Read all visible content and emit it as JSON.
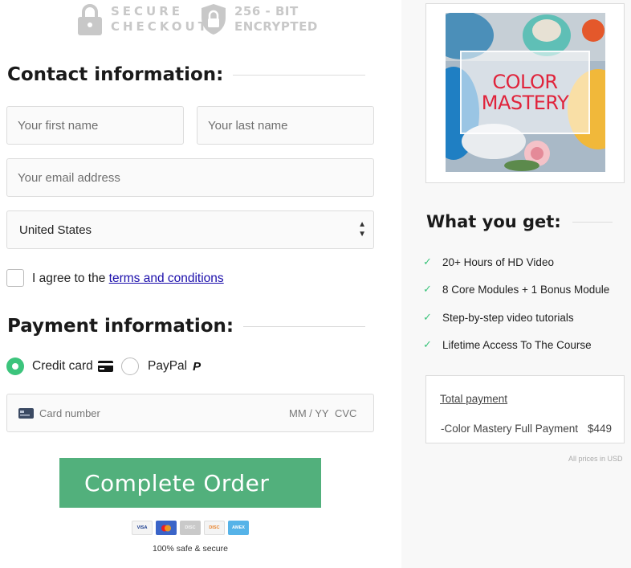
{
  "badges": {
    "secure_line1": "SECURE",
    "secure_line2": "CHECKOUT",
    "encrypt_line1": "256 - BIT",
    "encrypt_line2": "ENCRYPTED"
  },
  "contact": {
    "title": "Contact information:",
    "first_name_placeholder": "Your first name",
    "last_name_placeholder": "Your last name",
    "email_placeholder": "Your email address",
    "country": "United States",
    "agree_text": "I agree to the",
    "terms_link": "terms and conditions"
  },
  "payment": {
    "title": "Payment information:",
    "credit_card_label": "Credit card",
    "paypal_label": "PayPal",
    "card_number_placeholder": "Card number",
    "expiry_placeholder": "MM / YY",
    "cvc_placeholder": "CVC",
    "complete_button": "Complete Order",
    "card_brands": [
      "VISA",
      "MC",
      "DISC",
      "DISC",
      "AMEX"
    ],
    "safe_text": "100% safe & secure"
  },
  "product": {
    "title_line1": "COLOR",
    "title_line2": "MASTERY"
  },
  "what_you_get": {
    "title": "What you get:",
    "features": [
      "20+ Hours of HD Video",
      "8 Core Modules + 1 Bonus Module",
      "Step-by-step video tutorials",
      "Lifetime Access To The Course"
    ]
  },
  "summary": {
    "total_label": "Total payment",
    "item_label": "-Color Mastery Full Payment",
    "item_price": "$449",
    "currency_note": "All prices in USD"
  },
  "colors": {
    "accent_green": "#52b07c",
    "check_green": "#3cc47c",
    "link_blue": "#1a0dab"
  }
}
